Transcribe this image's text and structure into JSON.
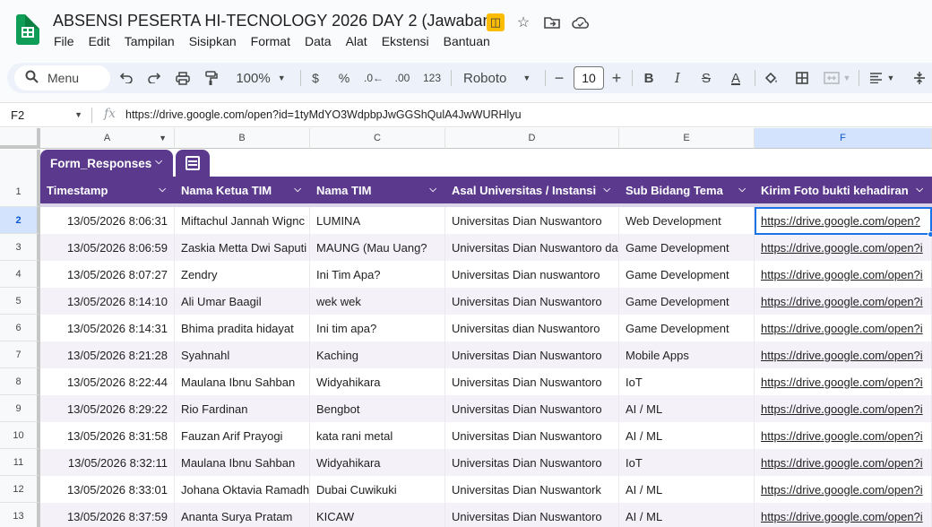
{
  "app": {
    "title": "ABSENSI PESERTA HI-TECNOLOGY 2026 DAY 2 (Jawaban)",
    "icons": [
      "sheets-logo-icon",
      "no-sync-icon",
      "star-icon",
      "move-folder-icon",
      "cloud-status-icon"
    ]
  },
  "menu": [
    "File",
    "Edit",
    "Tampilan",
    "Sisipkan",
    "Format",
    "Data",
    "Alat",
    "Ekstensi",
    "Bantuan"
  ],
  "toolbar": {
    "search_label": "Menu",
    "zoom": "100%",
    "currency": "$",
    "percent": "%",
    "dec_decrease": ".0←",
    "dec_increase": ".00",
    "format_123": "123",
    "font": "Roboto",
    "font_size": "10",
    "bold": "B",
    "italic": "I",
    "strike": "S",
    "text_color": "A"
  },
  "formula_bar": {
    "cell_ref": "F2",
    "fx": "fx",
    "value": "https://drive.google.com/open?id=1tyMdYO3WdpbpJwGGShQulA4JwWURHlyu"
  },
  "columns": [
    "A",
    "B",
    "C",
    "D",
    "E",
    "F"
  ],
  "selected_column": "F",
  "table": {
    "tab_name": "Form_Responses",
    "headers": [
      "Timestamp",
      "Nama Ketua TIM",
      "Nama TIM",
      "Asal Universitas / Instansi",
      "Sub Bidang Tema",
      "Kirim Foto bukti kehadiran"
    ],
    "rows": [
      [
        "13/05/2026 8:06:31",
        "Miftachul Jannah Wignc",
        "LUMINA",
        "Universitas Dian Nuswantoro",
        "Web Development",
        "https://drive.google.com/open?"
      ],
      [
        "13/05/2026 8:06:59",
        "Zaskia Metta Dwi Saputi",
        "MAUNG (Mau Uang?",
        "Universitas Dian Nuswantoro da",
        "Game Development",
        "https://drive.google.com/open?i"
      ],
      [
        "13/05/2026 8:07:27",
        "Zendry",
        "Ini Tim Apa?",
        "Universitas Dian nuswantoro",
        "Game Development",
        "https://drive.google.com/open?i"
      ],
      [
        "13/05/2026 8:14:10",
        "Ali Umar Baagil",
        "wek wek",
        "Universitas Dian Nuswantoro",
        "Game Development",
        "https://drive.google.com/open?i"
      ],
      [
        "13/05/2026 8:14:31",
        "Bhima pradita hidayat",
        "Ini tim apa?",
        "Universitas dian Nuswantoro",
        "Game Development",
        "https://drive.google.com/open?i"
      ],
      [
        "13/05/2026 8:21:28",
        "Syahnahl",
        "Kaching",
        "Universitas Dian Nuswantoro",
        "Mobile Apps",
        "https://drive.google.com/open?i"
      ],
      [
        "13/05/2026 8:22:44",
        "Maulana Ibnu Sahban",
        "Widyahikara",
        "Universitas Dian Nuswantoro",
        "IoT",
        "https://drive.google.com/open?i"
      ],
      [
        "13/05/2026 8:29:22",
        "Rio Fardinan",
        "Bengbot",
        "Universitas Dian Nuswantoro",
        "AI / ML",
        "https://drive.google.com/open?i"
      ],
      [
        "13/05/2026 8:31:58",
        "Fauzan Arif Prayogi",
        "kata rani metal",
        "Universitas Dian Nuswantoro",
        "AI / ML",
        "https://drive.google.com/open?i"
      ],
      [
        "13/05/2026 8:32:11",
        "Maulana Ibnu Sahban",
        "Widyahikara",
        "Universitas Dian Nuswantoro",
        "IoT",
        "https://drive.google.com/open?i"
      ],
      [
        "13/05/2026 8:33:01",
        "Johana Oktavia Ramadh",
        "Dubai Cuwikuki",
        "Universitas Dian Nuswantork",
        "AI / ML",
        "https://drive.google.com/open?i"
      ],
      [
        "13/05/2026 8:37:59",
        "Ananta Surya Pratam",
        "KICAW",
        "Universitas Dian Nuswantoro",
        "AI / ML",
        "https://drive.google.com/open?i"
      ]
    ]
  },
  "row_numbers": [
    "1",
    "2",
    "3",
    "4",
    "5",
    "6",
    "7",
    "8",
    "9",
    "10",
    "11",
    "12",
    "13"
  ],
  "selected_row": "2",
  "colors": {
    "table_header": "#5b3a8e",
    "banded_row": "#f4f1f8",
    "selection": "#1a73e8"
  }
}
